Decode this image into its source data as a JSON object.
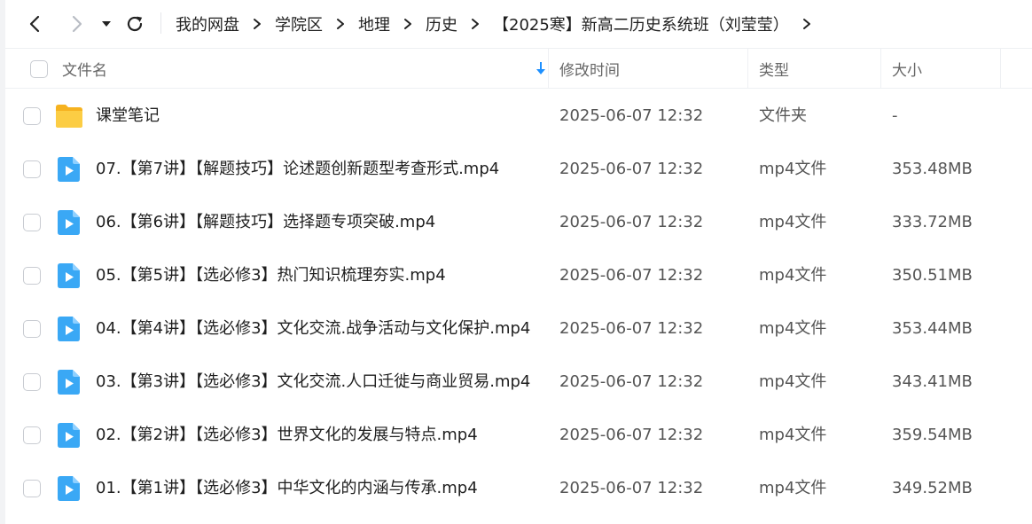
{
  "nav": {
    "back_icon": "chevron-left-icon",
    "forward_icon": "chevron-right-icon",
    "dropdown_icon": "caret-down-icon",
    "refresh_icon": "refresh-icon"
  },
  "breadcrumb": [
    {
      "label": "我的网盘"
    },
    {
      "label": "学院区"
    },
    {
      "label": "地理"
    },
    {
      "label": "历史"
    },
    {
      "label": "【2025寒】新高二历史系统班（刘莹莹）"
    }
  ],
  "columns": {
    "name": "文件名",
    "modified": "修改时间",
    "type": "类型",
    "size": "大小",
    "sort_icon": "arrow-down-icon"
  },
  "colors": {
    "accent": "#1e90ff",
    "folder": "#f6c13a",
    "video": "#3aa8f5"
  },
  "files": [
    {
      "icon": "folder-icon",
      "name": "课堂笔记",
      "modified": "2025-06-07 12:32",
      "type": "文件夹",
      "size": "-"
    },
    {
      "icon": "video-file-icon",
      "name": "07.【第7讲】【解题技巧】论述题创新题型考查形式.mp4",
      "modified": "2025-06-07 12:32",
      "type": "mp4文件",
      "size": "353.48MB"
    },
    {
      "icon": "video-file-icon",
      "name": "06.【第6讲】【解题技巧】选择题专项突破.mp4",
      "modified": "2025-06-07 12:32",
      "type": "mp4文件",
      "size": "333.72MB"
    },
    {
      "icon": "video-file-icon",
      "name": "05.【第5讲】【选必修3】热门知识梳理夯实.mp4",
      "modified": "2025-06-07 12:32",
      "type": "mp4文件",
      "size": "350.51MB"
    },
    {
      "icon": "video-file-icon",
      "name": "04.【第4讲】【选必修3】文化交流.战争活动与文化保护.mp4",
      "modified": "2025-06-07 12:32",
      "type": "mp4文件",
      "size": "353.44MB"
    },
    {
      "icon": "video-file-icon",
      "name": "03.【第3讲】【选必修3】文化交流.人口迁徙与商业贸易.mp4",
      "modified": "2025-06-07 12:32",
      "type": "mp4文件",
      "size": "343.41MB"
    },
    {
      "icon": "video-file-icon",
      "name": "02.【第2讲】【选必修3】世界文化的发展与特点.mp4",
      "modified": "2025-06-07 12:32",
      "type": "mp4文件",
      "size": "359.54MB"
    },
    {
      "icon": "video-file-icon",
      "name": "01.【第1讲】【选必修3】中华文化的内涵与传承.mp4",
      "modified": "2025-06-07 12:32",
      "type": "mp4文件",
      "size": "349.52MB"
    }
  ]
}
